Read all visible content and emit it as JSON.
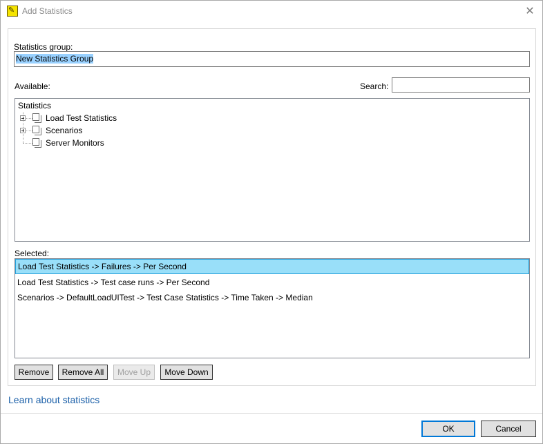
{
  "window": {
    "title": "Add Statistics",
    "app_icon_glyph": "✎",
    "close_glyph": "✕"
  },
  "form": {
    "group_label": "Statistics group:",
    "group_value": "New Statistics Group",
    "available_label": "Available:",
    "search_label": "Search:",
    "search_value": "",
    "selected_label": "Selected:"
  },
  "tree": {
    "root": "Statistics",
    "items": [
      {
        "label": "Load Test Statistics",
        "expandable": true
      },
      {
        "label": "Scenarios",
        "expandable": true
      },
      {
        "label": "Server Monitors",
        "expandable": false
      }
    ]
  },
  "selected_list": [
    "Load Test Statistics -> Failures -> Per Second",
    "Load Test Statistics -> Test case runs -> Per Second",
    "Scenarios -> DefaultLoadUITest -> Test Case Statistics -> Time Taken -> Median"
  ],
  "list_buttons": {
    "remove": "Remove",
    "remove_all": "Remove All",
    "move_up": "Move Up",
    "move_down": "Move Down"
  },
  "learn_link": "Learn about statistics",
  "dialog_buttons": {
    "ok": "OK",
    "cancel": "Cancel"
  },
  "colors": {
    "selection": "#99dff9",
    "link": "#1a5fa8",
    "default_button_border": "#0078d7"
  }
}
